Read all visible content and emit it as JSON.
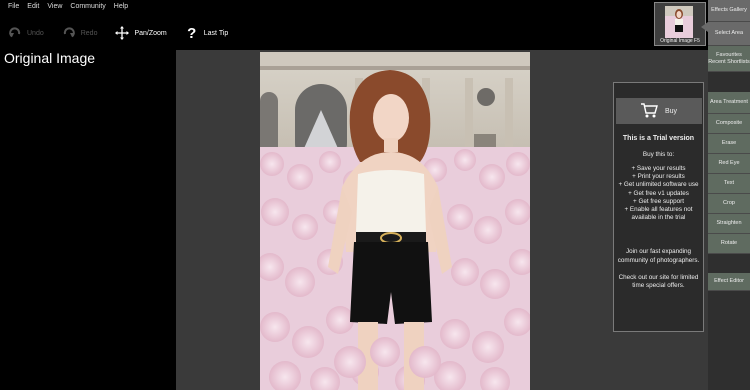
{
  "menu": [
    "File",
    "Edit",
    "View",
    "Community",
    "Help"
  ],
  "toolbar": {
    "undo": "Undo",
    "redo": "Redo",
    "pan_zoom": "Pan/Zoom",
    "last_tip": "Last Tip"
  },
  "title": "Original Image",
  "trial": {
    "buy": "Buy",
    "heading": "This is a Trial version",
    "buy_intro": "Buy this to:",
    "benefits": [
      "+ Save your results",
      "+ Print your results",
      "+ Get unlimited software use",
      "+ Get free v1 updates",
      "+ Get free support",
      "+ Enable all features not",
      "available in the trial"
    ],
    "community_1": "Join our fast expanding",
    "community_2": "community of photographers.",
    "offers_1": "Check out our site for limited",
    "offers_2": "time special offers."
  },
  "gallery_thumb_label": "Original Image F5",
  "side_buttons": [
    "Effects Gallery",
    "Select Area",
    "Favourites Recent Shortlists",
    "Area Treatment",
    "Composite",
    "Erase",
    "Red Eye",
    "Text",
    "Crop",
    "Straighten",
    "Rotate",
    "Effect Editor"
  ],
  "colors": {
    "panel_bg": "#3a3a3a",
    "side_button": "#6a6a6a",
    "side_button_green": "#5f6b60"
  }
}
